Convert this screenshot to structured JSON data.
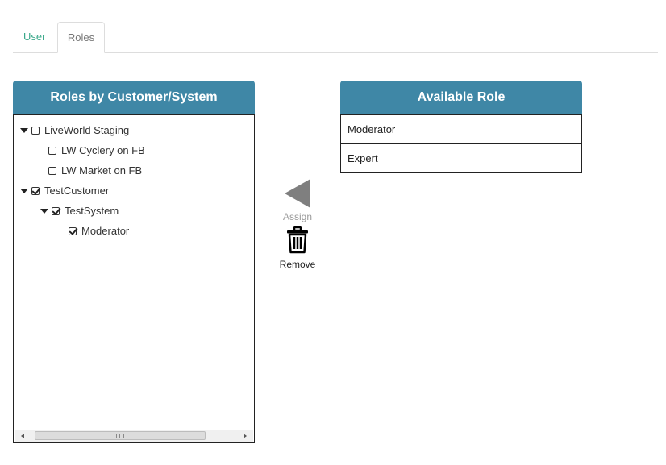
{
  "tabs": [
    {
      "label": "User"
    },
    {
      "label": "Roles"
    }
  ],
  "left_panel": {
    "title": "Roles by Customer/System",
    "tree": [
      {
        "label": "LiveWorld Staging",
        "checked": false,
        "expanded": true
      },
      {
        "label": "LW Cyclery on FB",
        "checked": false
      },
      {
        "label": "LW Market on FB",
        "checked": false
      },
      {
        "label": "TestCustomer",
        "checked": true,
        "expanded": true
      },
      {
        "label": "TestSystem",
        "checked": true,
        "expanded": true
      },
      {
        "label": "Moderator",
        "checked": true
      }
    ],
    "scrollbar_grip": "III"
  },
  "right_panel": {
    "title": "Available Role",
    "items": [
      {
        "label": "Moderator"
      },
      {
        "label": "Expert"
      }
    ]
  },
  "actions": {
    "assign_label": "Assign",
    "assign_icon": "left-arrow-icon",
    "remove_label": "Remove",
    "remove_icon": "trash-icon"
  },
  "colors": {
    "header_bg": "#3f87a6",
    "tab_user": "#3aa88a",
    "assign_arrow": "#7f7f7f"
  }
}
